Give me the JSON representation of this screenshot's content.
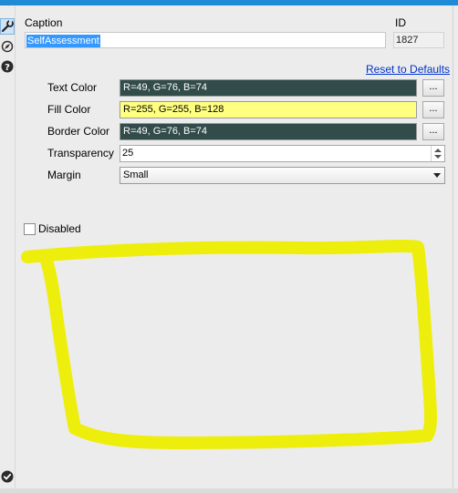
{
  "toolbar": {
    "dots": "..."
  },
  "form": {
    "caption_label": "Caption",
    "caption_value": "SelfAssessment",
    "id_label": "ID",
    "id_value": "1827",
    "reset_link": "Reset to Defaults",
    "text_color": {
      "label": "Text Color",
      "value": "R=49, G=76, B=74",
      "bg": "#314C4A",
      "fg": "#ffffff"
    },
    "fill_color": {
      "label": "Fill Color",
      "value": "R=255, G=255, B=128",
      "bg": "#FFFF80",
      "fg": "#000000"
    },
    "border_color": {
      "label": "Border Color",
      "value": "R=49, G=76, B=74",
      "bg": "#314C4A",
      "fg": "#ffffff"
    },
    "ellipsis": "...",
    "transparency_label": "Transparency",
    "transparency_value": "25",
    "margin_label": "Margin",
    "margin_value": "Small",
    "disabled_label": "Disabled",
    "disabled_checked": false
  },
  "annotation": {
    "color": "#EEEE00"
  }
}
